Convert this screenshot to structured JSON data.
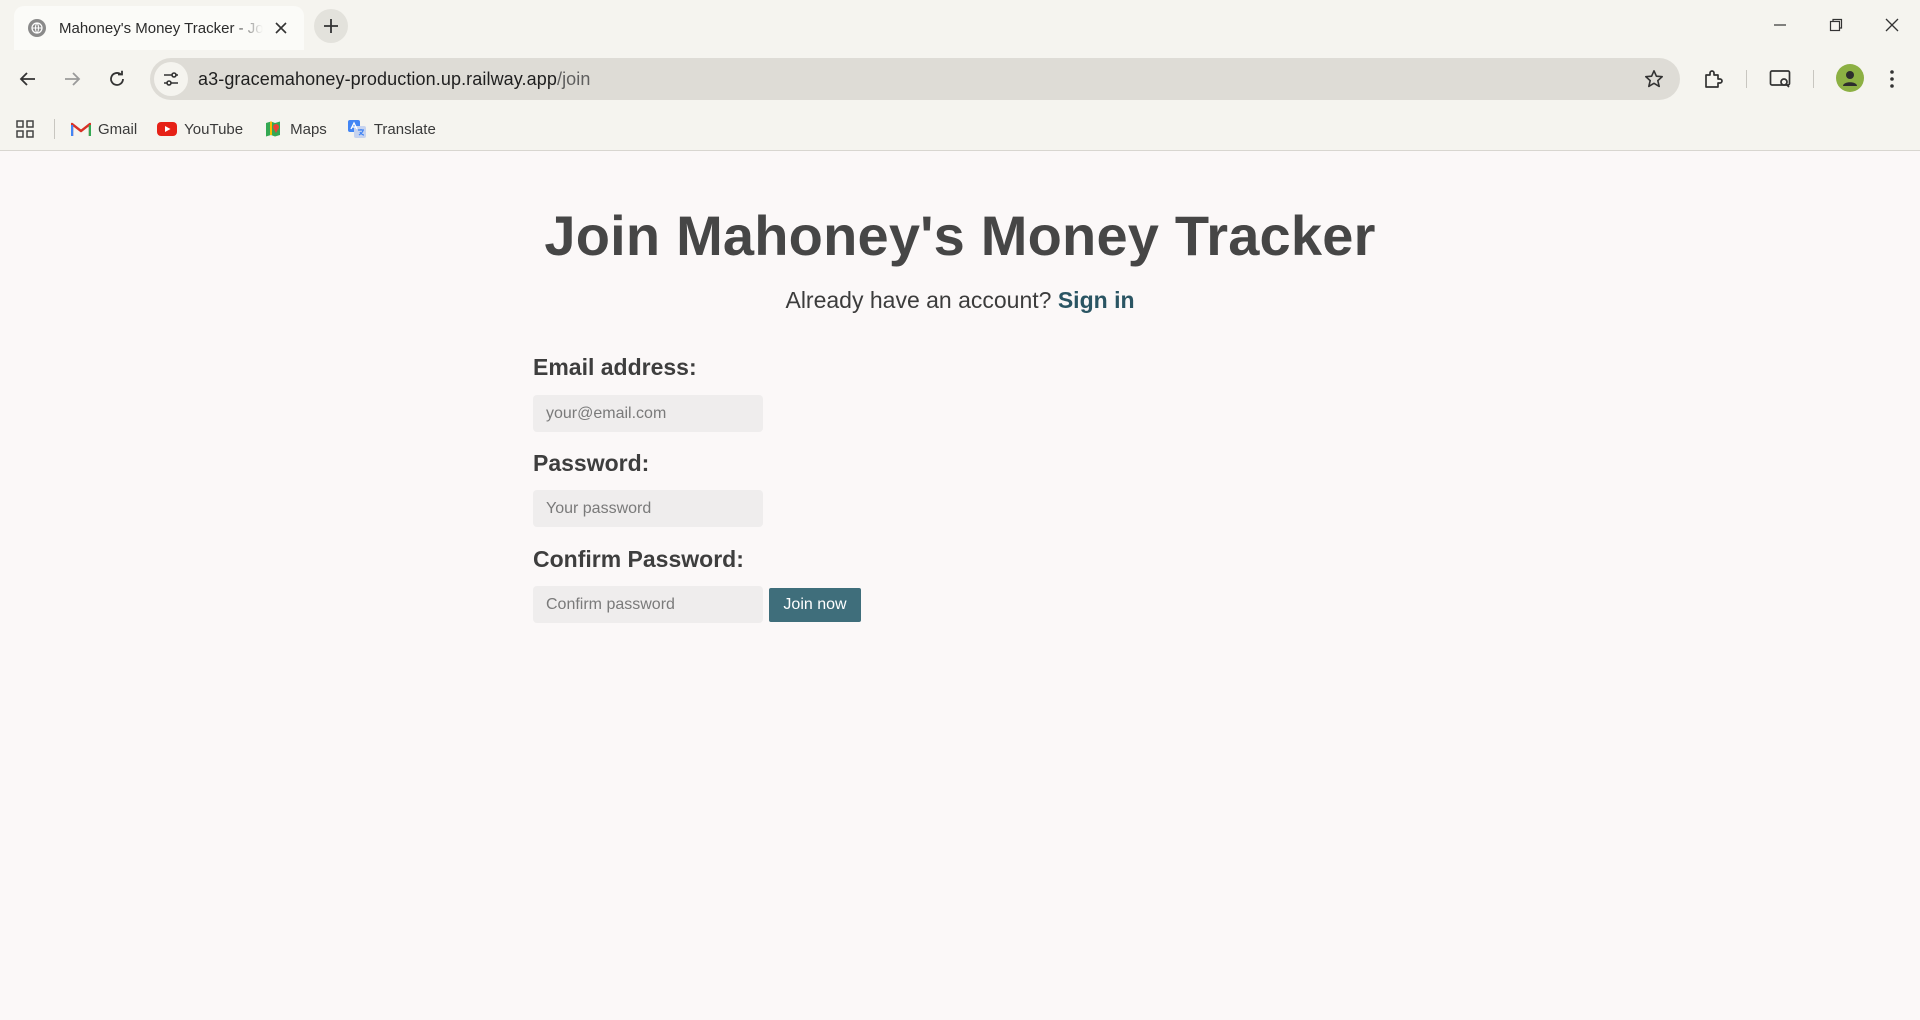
{
  "browser": {
    "tab": {
      "title": "Mahoney's Money Tracker - Join",
      "favicon": "globe-icon"
    },
    "new_tab_icon": "plus-icon",
    "window_controls": [
      "minimize-icon",
      "restore-icon",
      "close-icon"
    ],
    "address": {
      "host": "a3-gracemahoney-production.up.railway.app",
      "path": "/join"
    },
    "bookmarks": [
      {
        "label": "Gmail",
        "icon": "gmail-icon"
      },
      {
        "label": "YouTube",
        "icon": "youtube-icon"
      },
      {
        "label": "Maps",
        "icon": "maps-icon"
      },
      {
        "label": "Translate",
        "icon": "translate-icon"
      }
    ]
  },
  "page": {
    "heading": "Join Mahoney's Money Tracker",
    "signin_prompt": "Already have an account?",
    "signin_link": "Sign in",
    "form": {
      "email_label": "Email address:",
      "email_placeholder": "your@email.com",
      "email_value": "",
      "password_label": "Password:",
      "password_placeholder": "Your password",
      "password_value": "",
      "confirm_label": "Confirm Password:",
      "confirm_placeholder": "Confirm password",
      "confirm_value": "",
      "submit_label": "Join now"
    }
  },
  "colors": {
    "page_bg": "#fbf8f8",
    "heading": "#464646",
    "link": "#2a5563",
    "button_bg": "#3f6e7b",
    "input_bg": "#efeded"
  }
}
